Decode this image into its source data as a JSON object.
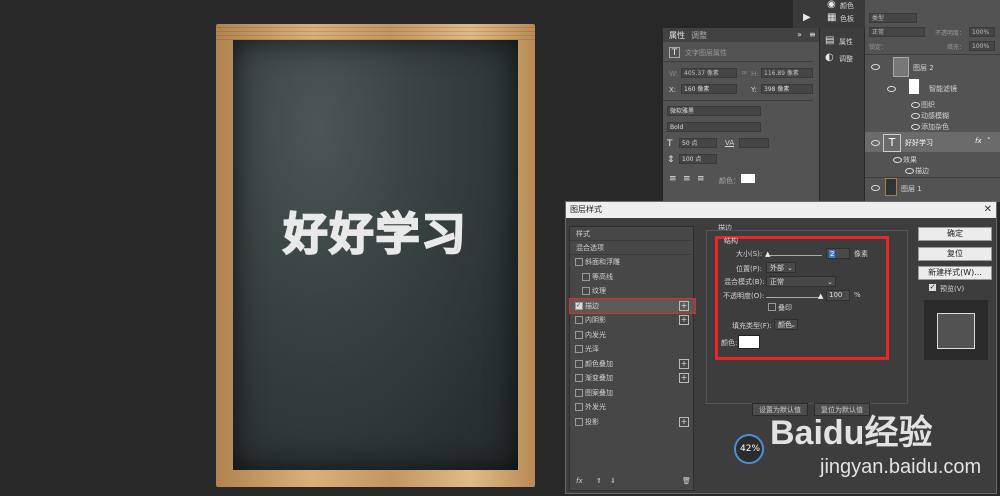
{
  "board": {
    "title": "好好学习"
  },
  "top_panel": {
    "color_tab": "颜色",
    "swatch_tab": "色板"
  },
  "properties": {
    "tabs": [
      "属性",
      "调整"
    ],
    "header": "文字图层属性",
    "w_label": "W:",
    "w_value": "405.37 像素",
    "h_label": "H:",
    "h_value": "116.89 像素",
    "x_label": "X:",
    "x_value": "160 像素",
    "y_label": "Y:",
    "y_value": "398 像素",
    "font_family": "微软雅黑",
    "font_style": "Bold",
    "font_size": "50 点",
    "tracking_icon": "VA",
    "scale": "100 点",
    "color_label": "颜色：",
    "color": "#ffffff"
  },
  "side_dock": {
    "properties": "属性",
    "adjust": "调整"
  },
  "layers": {
    "kind": "类型",
    "blend": "正常",
    "opacity_label": "不透明度：",
    "opacity": "100%",
    "lock_label": "锁定：",
    "fill_label": "填充：",
    "fill": "100%",
    "items": [
      {
        "name": "图层 2"
      },
      {
        "name": "智能滤镜"
      },
      {
        "name": "图织"
      },
      {
        "name": "动感模糊"
      },
      {
        "name": "添加杂色"
      },
      {
        "name": "好好学习"
      },
      {
        "name": "效果"
      },
      {
        "name": "描边"
      },
      {
        "name": "图层 1"
      }
    ],
    "fx_label": "fx"
  },
  "dialog": {
    "title": "图层样式",
    "styles_header": "样式",
    "blend_options": "混合选项",
    "styles": [
      {
        "label": "斜面和浮雕",
        "checked": false,
        "plus": false,
        "indent": false
      },
      {
        "label": "等高线",
        "checked": false,
        "plus": false,
        "indent": true
      },
      {
        "label": "纹理",
        "checked": false,
        "plus": false,
        "indent": true
      },
      {
        "label": "描边",
        "checked": true,
        "plus": true,
        "indent": false
      },
      {
        "label": "内阴影",
        "checked": false,
        "plus": true,
        "indent": false
      },
      {
        "label": "内发光",
        "checked": false,
        "plus": false,
        "indent": false
      },
      {
        "label": "光泽",
        "checked": false,
        "plus": false,
        "indent": false
      },
      {
        "label": "颜色叠加",
        "checked": false,
        "plus": true,
        "indent": false
      },
      {
        "label": "渐变叠加",
        "checked": false,
        "plus": true,
        "indent": false
      },
      {
        "label": "图案叠加",
        "checked": false,
        "plus": false,
        "indent": false
      },
      {
        "label": "外发光",
        "checked": false,
        "plus": false,
        "indent": false
      },
      {
        "label": "投影",
        "checked": false,
        "plus": true,
        "indent": false
      }
    ],
    "fx_label": "fx",
    "section_title": "描边",
    "group_title": "结构",
    "size_label": "大小(S):",
    "size_value": "2",
    "size_unit": "像素",
    "position_label": "位置(P):",
    "position_value": "外部",
    "blend_label": "混合模式(B):",
    "blend_value": "正常",
    "opacity_label": "不透明度(O):",
    "opacity_value": "100",
    "opacity_unit": "%",
    "opacity_slider_fraction": 0.97,
    "overprint_label": "叠印",
    "fill_type_label": "填充类型(F):",
    "fill_type_value": "颜色",
    "color_label": "颜色:",
    "color_value": "#ffffff",
    "set_default": "设置为默认值",
    "reset_default": "复位为默认值",
    "ok": "确定",
    "reset": "复位",
    "new_style": "新建样式(W)...",
    "preview_label": "预览(V)",
    "progress_percent": "42%",
    "progress_fraction": 0.42
  },
  "watermark": {
    "brand": "Baidu经验",
    "url": "jingyan.baidu.com"
  },
  "colors": {
    "accent_red": "#e8262b",
    "panel": "#535353",
    "dialog": "#3d3d3d"
  }
}
